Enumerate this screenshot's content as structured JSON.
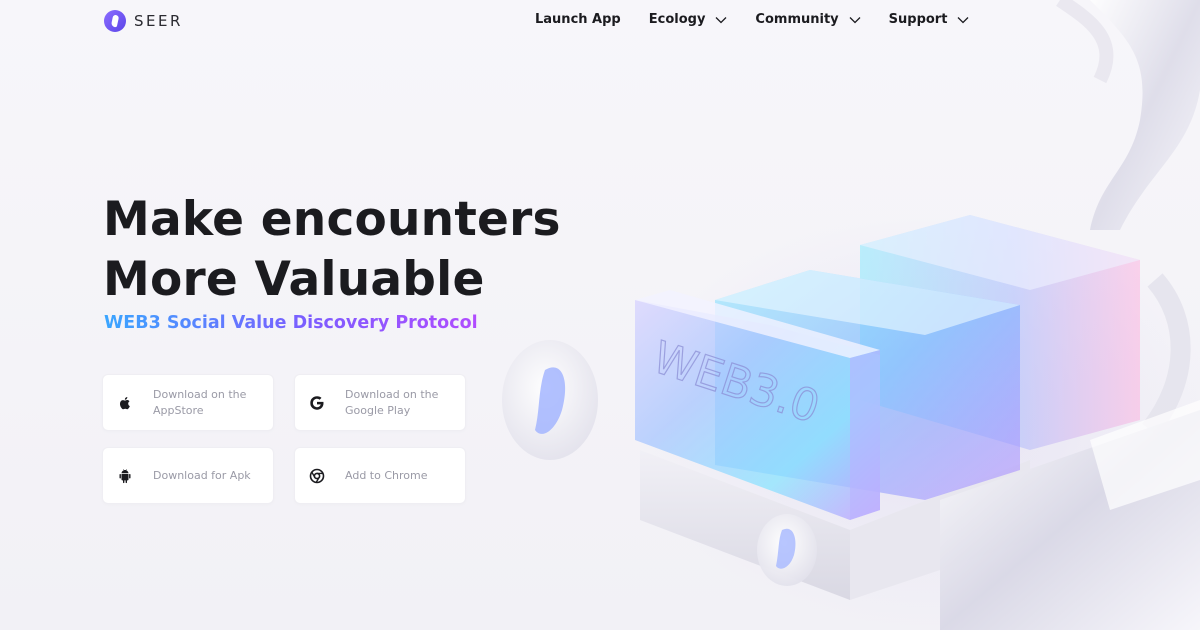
{
  "brand": {
    "name": "SEER",
    "accent": "#6a52f0"
  },
  "nav": {
    "items": [
      {
        "label": "Launch App",
        "has_dropdown": false
      },
      {
        "label": "Ecology",
        "has_dropdown": true
      },
      {
        "label": "Community",
        "has_dropdown": true
      },
      {
        "label": "Support",
        "has_dropdown": true
      }
    ]
  },
  "hero": {
    "title_line1": "Make encounters",
    "title_line2": "More Valuable",
    "subtitle": "WEB3 Social Value Discovery Protocol"
  },
  "downloads": [
    {
      "label": "Download on the AppStore",
      "icon": "apple-icon"
    },
    {
      "label": "Download on the Google Play",
      "icon": "google-icon"
    },
    {
      "label": "Download for Apk",
      "icon": "android-icon"
    },
    {
      "label": "Add to Chrome",
      "icon": "chrome-icon"
    }
  ],
  "illustration": {
    "text": "WEB3.0"
  }
}
